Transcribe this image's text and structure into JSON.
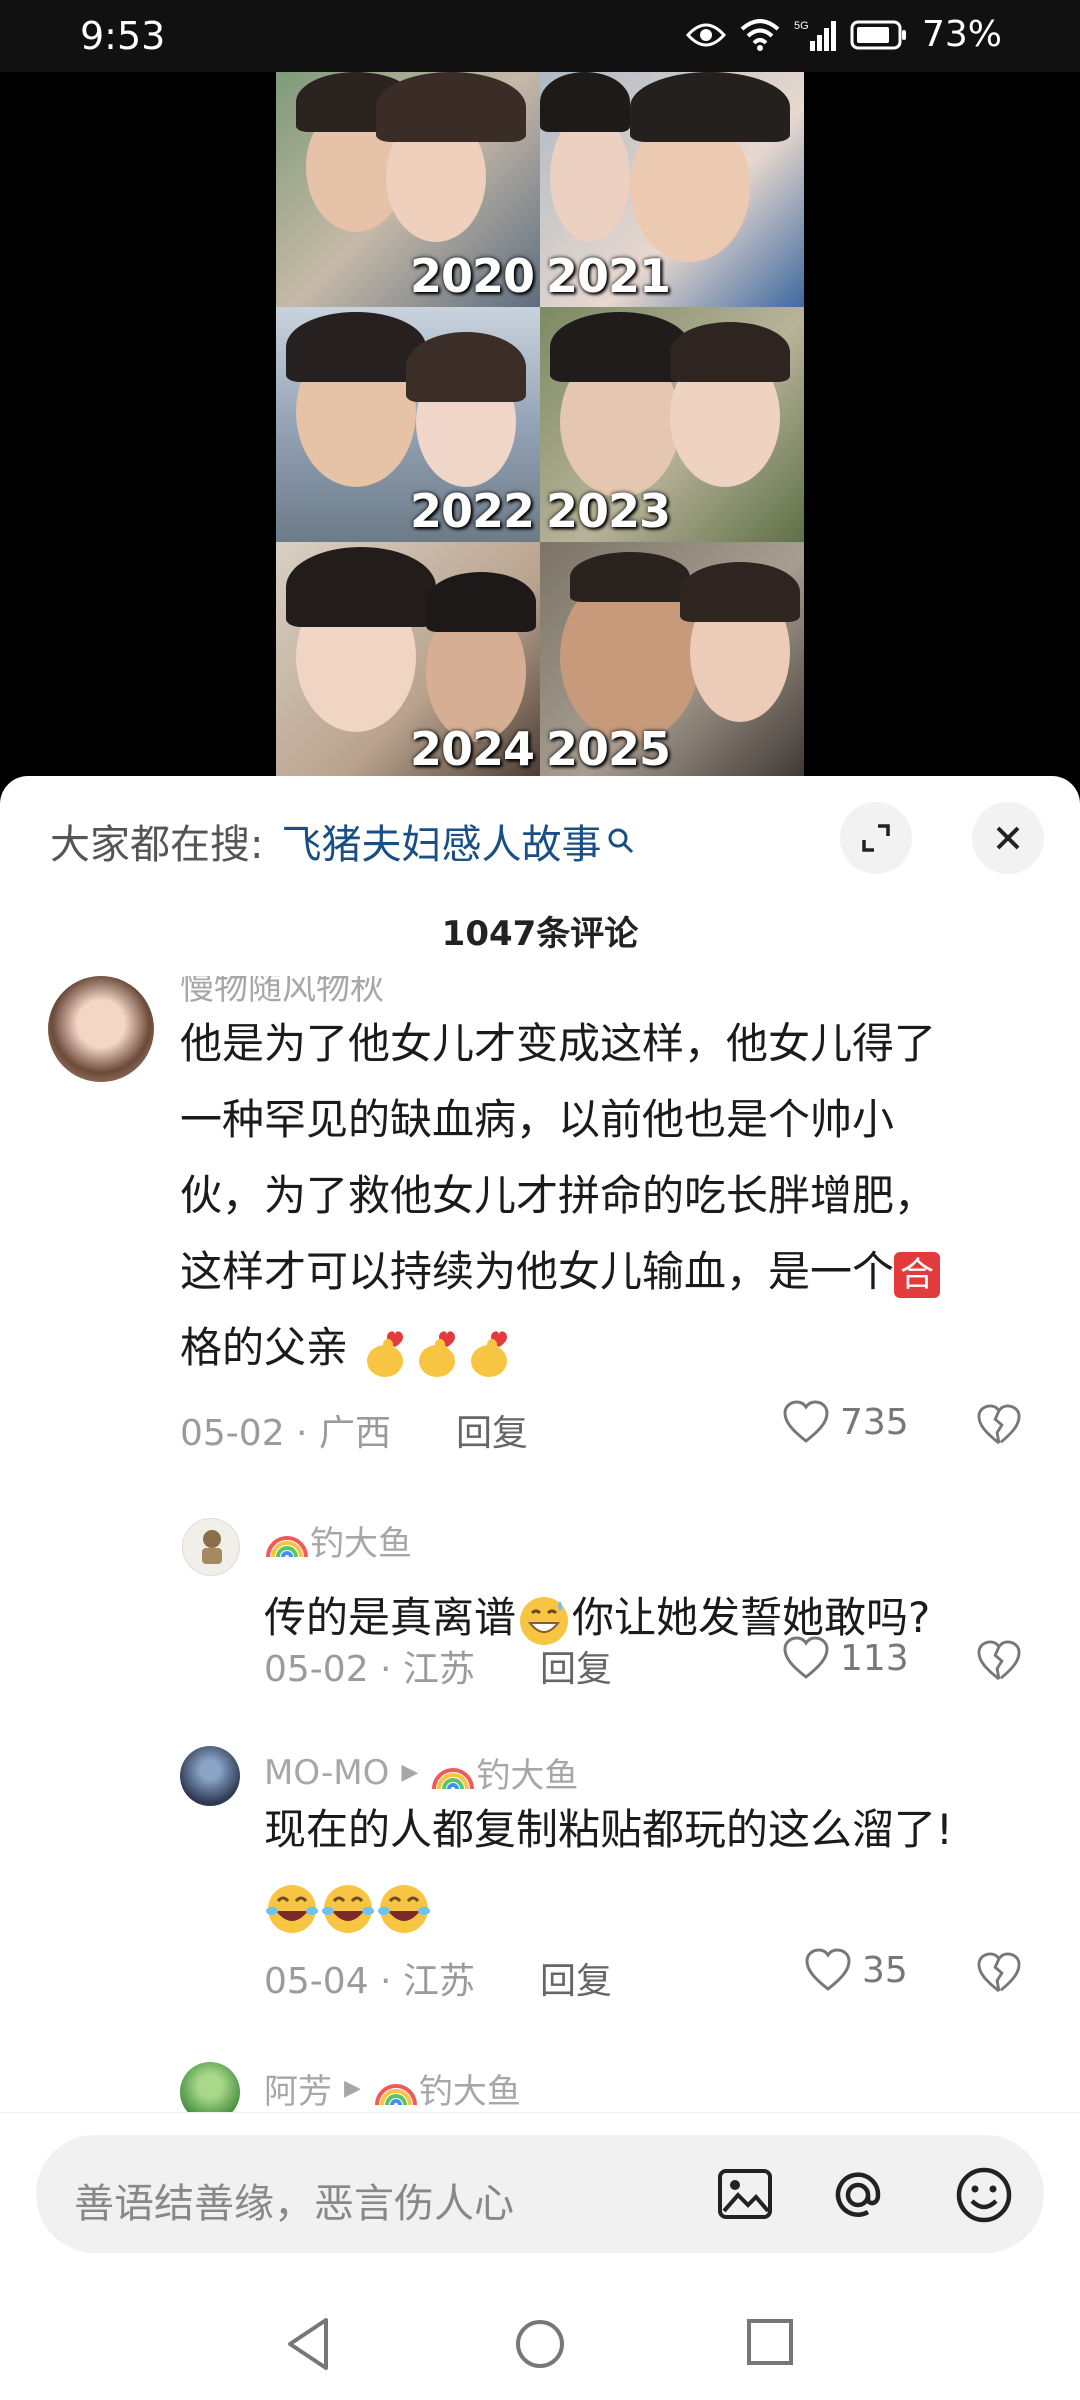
{
  "status_bar": {
    "time": "9:53",
    "battery": "73%",
    "network": "5G"
  },
  "video": {
    "years": [
      "2020",
      "2021",
      "2022",
      "2023",
      "2024",
      "2025"
    ]
  },
  "sheet": {
    "search_prefix": "大家都在搜:",
    "search_term": "飞猪夫妇感人故事",
    "comment_count": "1047条评论"
  },
  "comments": [
    {
      "user": "慢物随风物秋",
      "text_lines": [
        "他是为了他女儿才变成这样，他女儿得了",
        "一种罕见的缺血病，以前他也是个帅小",
        "伙，为了救他女儿才拼命的吃长胖增肥，",
        "这样才可以持续为他女儿输血，是一个",
        "格的父亲"
      ],
      "badge": "合",
      "date_loc": "05-02 · 广西",
      "reply": "回复",
      "likes": "735"
    },
    {
      "user": "钓大鱼",
      "text_before": "传的是真离谱",
      "text_after": "你让她发誓她敢吗?",
      "date_loc": "05-02 · 江苏",
      "reply": "回复",
      "likes": "113"
    },
    {
      "user": "MO-MO",
      "reply_to": "钓大鱼",
      "text": "现在的人都复制粘贴都玩的这么溜了!",
      "date_loc": "05-04 · 江苏",
      "reply": "回复",
      "likes": "35"
    },
    {
      "user": "阿芳",
      "reply_to": "钓大鱼"
    }
  ],
  "input": {
    "placeholder": "善语结善缘，恶言伤人心"
  },
  "icons": {
    "eye": "eye-icon",
    "wifi": "wifi-icon",
    "signal": "signal-icon",
    "battery": "battery-icon",
    "search": "search-icon",
    "expand": "expand-icon",
    "close": "close-icon",
    "like": "heart-icon",
    "dislike": "broken-heart-icon",
    "image": "image-icon",
    "mention": "at-icon",
    "emoji": "smiley-icon",
    "back": "back-icon",
    "home": "home-icon",
    "recents": "recents-icon"
  },
  "colors": {
    "link": "#1a4f86",
    "badge": "#e33b3b"
  }
}
